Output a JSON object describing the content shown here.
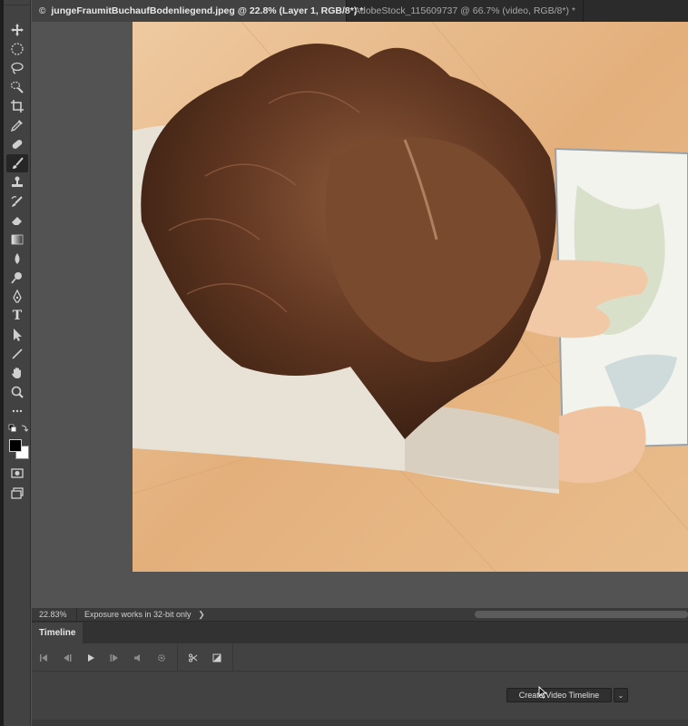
{
  "document_tabs": [
    {
      "label": "junge­FraumitBuchaufBodenliegend.jpeg @ 22.8% (Layer 1, RGB/8*) *"
    },
    {
      "label": "AdobeStock_115609737 @ 66.7% (video, RGB/8*) *"
    }
  ],
  "tabs_close_glyph": "©",
  "tools": [
    {
      "name": "move-tool-icon"
    },
    {
      "name": "marquee-tool-icon"
    },
    {
      "name": "lasso-tool-icon"
    },
    {
      "name": "quick-selection-tool-icon"
    },
    {
      "name": "crop-tool-icon"
    },
    {
      "name": "eyedropper-tool-icon"
    },
    {
      "name": "healing-brush-tool-icon"
    },
    {
      "name": "brush-tool-icon"
    },
    {
      "name": "clone-stamp-tool-icon"
    },
    {
      "name": "history-brush-tool-icon"
    },
    {
      "name": "eraser-tool-icon"
    },
    {
      "name": "gradient-tool-icon"
    },
    {
      "name": "blur-tool-icon"
    },
    {
      "name": "dodge-tool-icon"
    },
    {
      "name": "pen-tool-icon"
    },
    {
      "name": "type-tool-icon"
    },
    {
      "name": "path-selection-tool-icon"
    },
    {
      "name": "line-tool-icon"
    },
    {
      "name": "hand-tool-icon"
    },
    {
      "name": "zoom-tool-icon"
    }
  ],
  "type_tool_glyph": "T",
  "active_tool": "brush-tool-icon",
  "colors": {
    "foreground": "#000000",
    "background": "#ffffff"
  },
  "status": {
    "zoom": "22.83%",
    "info": "Exposure works in 32-bit only",
    "arrow": "❯"
  },
  "timeline": {
    "tab_label": "Timeline",
    "create_button": "Create Video Timeline",
    "dropdown_glyph": "⌄"
  }
}
